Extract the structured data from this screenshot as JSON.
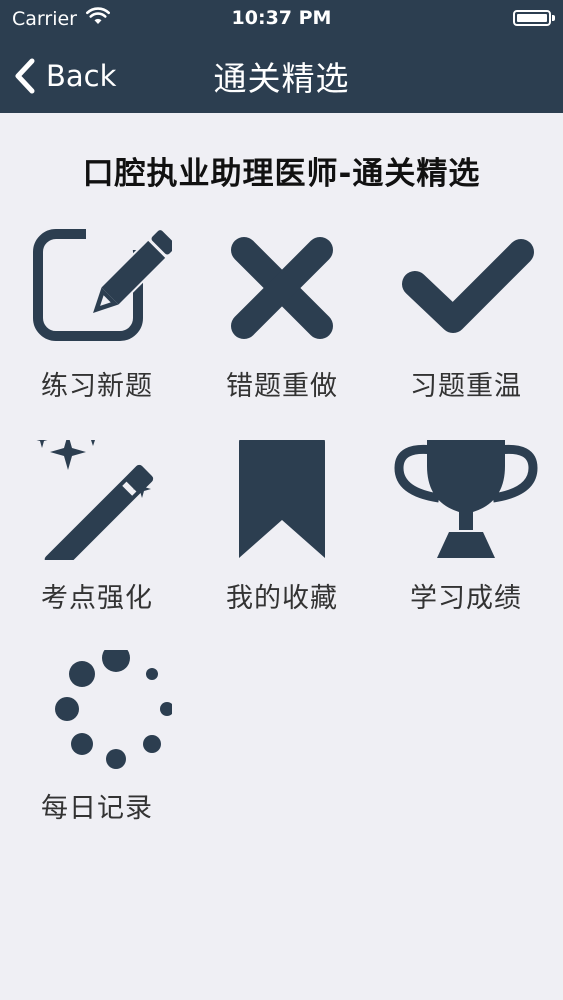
{
  "status_bar": {
    "carrier": "Carrier",
    "time": "10:37 PM"
  },
  "nav": {
    "back_label": "Back",
    "title": "通关精选"
  },
  "page": {
    "title": "口腔执业助理医师-通关精选"
  },
  "tiles": [
    {
      "label": "练习新题",
      "icon": "edit-icon"
    },
    {
      "label": "错题重做",
      "icon": "cross-icon"
    },
    {
      "label": "习题重温",
      "icon": "checkmark-icon"
    },
    {
      "label": "考点强化",
      "icon": "magic-wand-icon"
    },
    {
      "label": "我的收藏",
      "icon": "bookmark-icon"
    },
    {
      "label": "学习成绩",
      "icon": "trophy-icon"
    },
    {
      "label": "每日记录",
      "icon": "loading-spinner-icon"
    }
  ],
  "colors": {
    "navbar": "#2c3e50",
    "icon": "#2c3e50",
    "background": "#efeff4"
  }
}
